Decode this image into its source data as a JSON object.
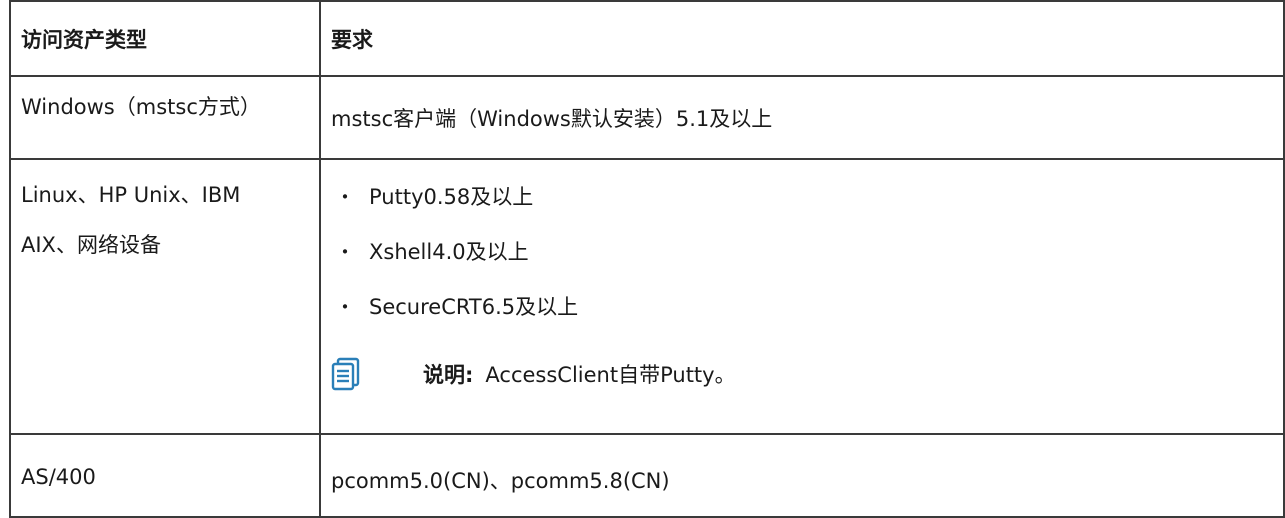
{
  "table": {
    "headers": [
      "访问资产类型",
      "要求"
    ],
    "rows": {
      "windows": {
        "type": "Windows（mstsc方式）",
        "requirement": "mstsc客户端（Windows默认安装）5.1及以上"
      },
      "linux": {
        "type_line1": "Linux、HP Unix、IBM",
        "type_line2": "AIX、网络设备",
        "bullet_symbol": "・",
        "requirements": [
          "Putty0.58及以上",
          "Xshell4.0及以上",
          "SecureCRT6.5及以上"
        ],
        "note_label": "说明:",
        "note_text": "AccessClient自带Putty。",
        "note_icon": "document-note-icon",
        "note_icon_color": "#2a7fb8"
      },
      "as400": {
        "type": "AS/400",
        "requirement": "pcomm5.0(CN)、pcomm5.8(CN)"
      }
    }
  },
  "colors": {
    "border": "#3a3a3a",
    "text": "#1a1a1a",
    "background": "#ffffff"
  }
}
